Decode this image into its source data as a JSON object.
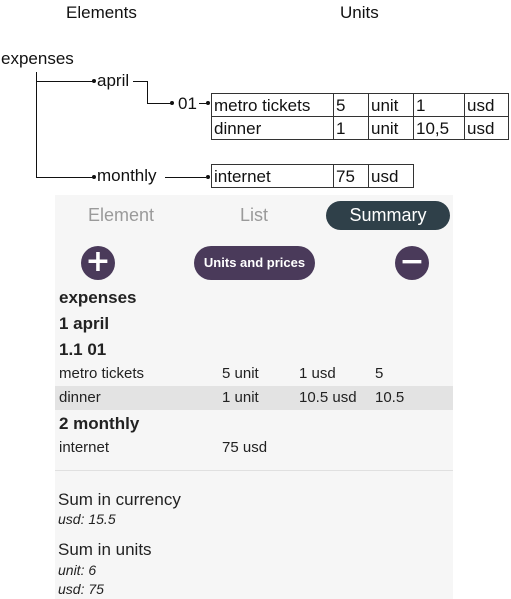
{
  "diagram": {
    "headings": {
      "elements": "Elements",
      "units": "Units"
    },
    "tree": {
      "root": "expenses",
      "april": "april",
      "sub_01": "01",
      "monthly": "monthly"
    },
    "table_april_01": [
      [
        "metro tickets",
        "5",
        "unit",
        "1",
        "usd"
      ],
      [
        "dinner",
        "1",
        "unit",
        "10,5",
        "usd"
      ]
    ],
    "table_monthly": [
      [
        "internet",
        "75",
        "usd"
      ]
    ]
  },
  "app": {
    "tabs": [
      {
        "label": "Element",
        "active": false
      },
      {
        "label": "List",
        "active": false
      },
      {
        "label": "Summary",
        "active": true
      }
    ],
    "toolbar": {
      "add_glyph": "+",
      "units_prices_label": "Units and prices",
      "remove_glyph": "−"
    },
    "summary": {
      "root_title": "expenses",
      "group1_title": "1 april",
      "group11_title": "1.1 01",
      "group11_rows": [
        {
          "name": "metro tickets",
          "qty": "5 unit",
          "price": "1 usd",
          "total": "5",
          "highlighted": false
        },
        {
          "name": "dinner",
          "qty": "1 unit",
          "price": "10.5 usd",
          "total": "10.5",
          "highlighted": true
        }
      ],
      "group2_title": "2 monthly",
      "group2_rows": [
        {
          "name": "internet",
          "qty": "75 usd"
        }
      ]
    },
    "totals": {
      "currency_title": "Sum in currency",
      "currency_values": [
        "usd: 15.5"
      ],
      "units_title": "Sum in units",
      "units_values": [
        "unit: 6",
        "usd: 75"
      ]
    },
    "colors": {
      "button_bg": "#4a3a5a",
      "active_tab_bg": "#2f4049",
      "panel_bg": "#f6f6f6",
      "highlight_row": "#e3e3e3"
    }
  }
}
